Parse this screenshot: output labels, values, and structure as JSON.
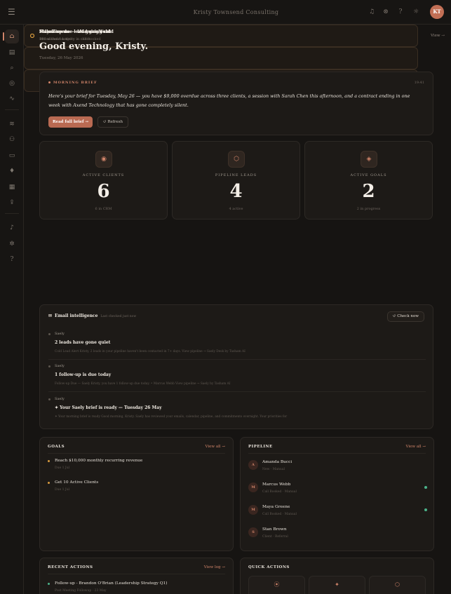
{
  "topbar": {
    "brand": "Kristy Townsend Consulting",
    "avatar_initials": "KT",
    "icons": [
      "bell-icon",
      "settings-icon",
      "help-icon",
      "theme-icon"
    ]
  },
  "sidebar": {
    "items": [
      {
        "icon": "home-icon",
        "glyph": "⌂"
      },
      {
        "icon": "document-icon",
        "glyph": "▤"
      },
      {
        "icon": "search-icon",
        "glyph": "⌕"
      },
      {
        "icon": "target-icon",
        "glyph": "◎"
      },
      {
        "icon": "activity-icon",
        "glyph": "∿"
      },
      {
        "icon": "layers-icon",
        "glyph": "≋"
      },
      {
        "icon": "users-icon",
        "glyph": "⚇"
      },
      {
        "icon": "chat-icon",
        "glyph": "▭"
      },
      {
        "icon": "mic-icon",
        "glyph": "♦"
      },
      {
        "icon": "grid-icon",
        "glyph": "▦"
      },
      {
        "icon": "upload-icon",
        "glyph": "⇪"
      },
      {
        "icon": "bell-icon",
        "glyph": "♪"
      },
      {
        "icon": "gear-icon",
        "glyph": "✲"
      },
      {
        "icon": "help-icon",
        "glyph": "?"
      }
    ]
  },
  "greeting": "Good evening, Kristy.",
  "date": "Tuesday, 26 May 2026",
  "brief": {
    "label": "MORNING BRIEF",
    "time": "19:41",
    "message": "Here's your brief for Tuesday, May 26 — you have $9,000 overdue across three clients, a session with Sarah Chen this afternoon, and a contract ending in one week with Axend Technology that has gone completely silent.",
    "read_button": "Read full brief →",
    "refresh_button": "↺ Refresh"
  },
  "stats": [
    {
      "label": "ACTIVE CLIENTS",
      "value": "6",
      "sub": "6 in CRM",
      "glyph": "◉"
    },
    {
      "label": "PIPELINE LEADS",
      "value": "4",
      "sub": "4 active",
      "glyph": "⬡"
    },
    {
      "label": "ACTIVE GOALS",
      "value": "2",
      "sub": "2 in progress",
      "glyph": "◈"
    }
  ],
  "alerts": [
    {
      "title": "Maya Greene — lead going cold",
      "sub": "19d without activity in call booked",
      "view": "View →"
    },
    {
      "title": "Stan Brown — lead going cold",
      "sub": "31d without activity in client",
      "view": "View →"
    },
    {
      "title": "Follow-up due — Marcus Webb",
      "sub": "Scheduled 1d ago",
      "view": "View →"
    }
  ],
  "email": {
    "title": "Email intelligence",
    "checked": "Last checked just now",
    "check_button": "↺ Check now",
    "items": [
      {
        "sender": "Saely",
        "subject": "2 leads have gone quiet",
        "snippet": "Cold Lead Alert Kristy, 2 leads in your pipeline haven't been contacted in 7+ days. View pipeline → Saely Desk by Tasham AI"
      },
      {
        "sender": "Saely",
        "subject": "1 follow-up is due today",
        "snippet": "Follow-up Due — Saely Kristy, you have 1 follow-up due today. • Marcus Webb View pipeline → Saely by Tasham AI"
      },
      {
        "sender": "Saely",
        "subject": "✦ Your Saely brief is ready — Tuesday 26 May",
        "snippet": "✦ Your morning brief is ready Good morning, Kristy. Saely has reviewed your emails, calendar, pipeline, and commitments overnight. Your priorities for"
      }
    ]
  },
  "goals": {
    "title": "GOALS",
    "link": "View all →",
    "items": [
      {
        "title": "Reach $10,000 monthly recurring revenue",
        "sub": "Due 1 Jul"
      },
      {
        "title": "Get 10 Active Clients",
        "sub": "Due 1 Jul"
      }
    ]
  },
  "pipeline": {
    "title": "PIPELINE",
    "link": "View all →",
    "items": [
      {
        "initial": "A",
        "name": "Amanda Bucci",
        "meta": "New · Manual",
        "status": false
      },
      {
        "initial": "M",
        "name": "Marcus Webb",
        "meta": "Call Booked · Manual",
        "status": true
      },
      {
        "initial": "M",
        "name": "Maya Greene",
        "meta": "Call Booked · Manual",
        "status": true
      },
      {
        "initial": "S",
        "name": "Stan Brown",
        "meta": "Client · Referral",
        "status": false
      }
    ]
  },
  "recent": {
    "title": "RECENT ACTIONS",
    "link": "View log →",
    "items": [
      {
        "title": "Follow-up - Brandon O'Brian (Leadership Strategy Q1)",
        "sub": "Post Meeting Followup · 23 May"
      }
    ]
  },
  "quick": {
    "title": "QUICK ACTIONS",
    "items": [
      {
        "icon": "record-icon",
        "glyph": "⦿"
      },
      {
        "icon": "sparkle-icon",
        "glyph": "✦"
      },
      {
        "icon": "hexagon-icon",
        "glyph": "⬡"
      }
    ]
  },
  "colors": {
    "accent": "#d2856a",
    "warning": "#d89b3e",
    "success": "#4bb38a",
    "background": "#161412"
  }
}
